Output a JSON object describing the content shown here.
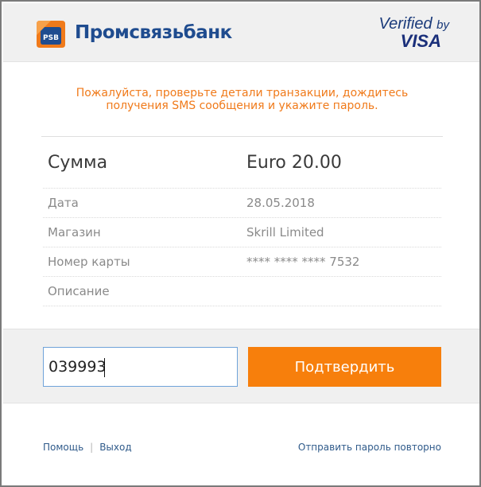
{
  "header": {
    "bank_name": "Промсвязьбанк",
    "bank_mark_text": "PSB",
    "verified_text": "Verified",
    "by_text": "by",
    "visa_text": "VISA"
  },
  "notice": {
    "line1": "Пожалуйста, проверьте детали транзакции, дождитесь",
    "line2": "получения SMS сообщения и укажите пароль."
  },
  "details": {
    "amount_label": "Сумма",
    "amount_value": "Euro 20.00",
    "date_label": "Дата",
    "date_value": "28.05.2018",
    "merchant_label": "Магазин",
    "merchant_value": "Skrill Limited",
    "card_label": "Номер карты",
    "card_value": "**** **** **** 7532",
    "description_label": "Описание",
    "description_value": ""
  },
  "form": {
    "code_value": "039993",
    "confirm_label": "Подтвердить"
  },
  "footer": {
    "help_label": "Помощь",
    "exit_label": "Выход",
    "resend_label": "Отправить пароль повторно"
  },
  "colors": {
    "accent_orange": "#f77f0c",
    "notice_orange": "#f07a1a",
    "bank_blue": "#1f4c8f",
    "link_blue": "#2f5a8a"
  }
}
